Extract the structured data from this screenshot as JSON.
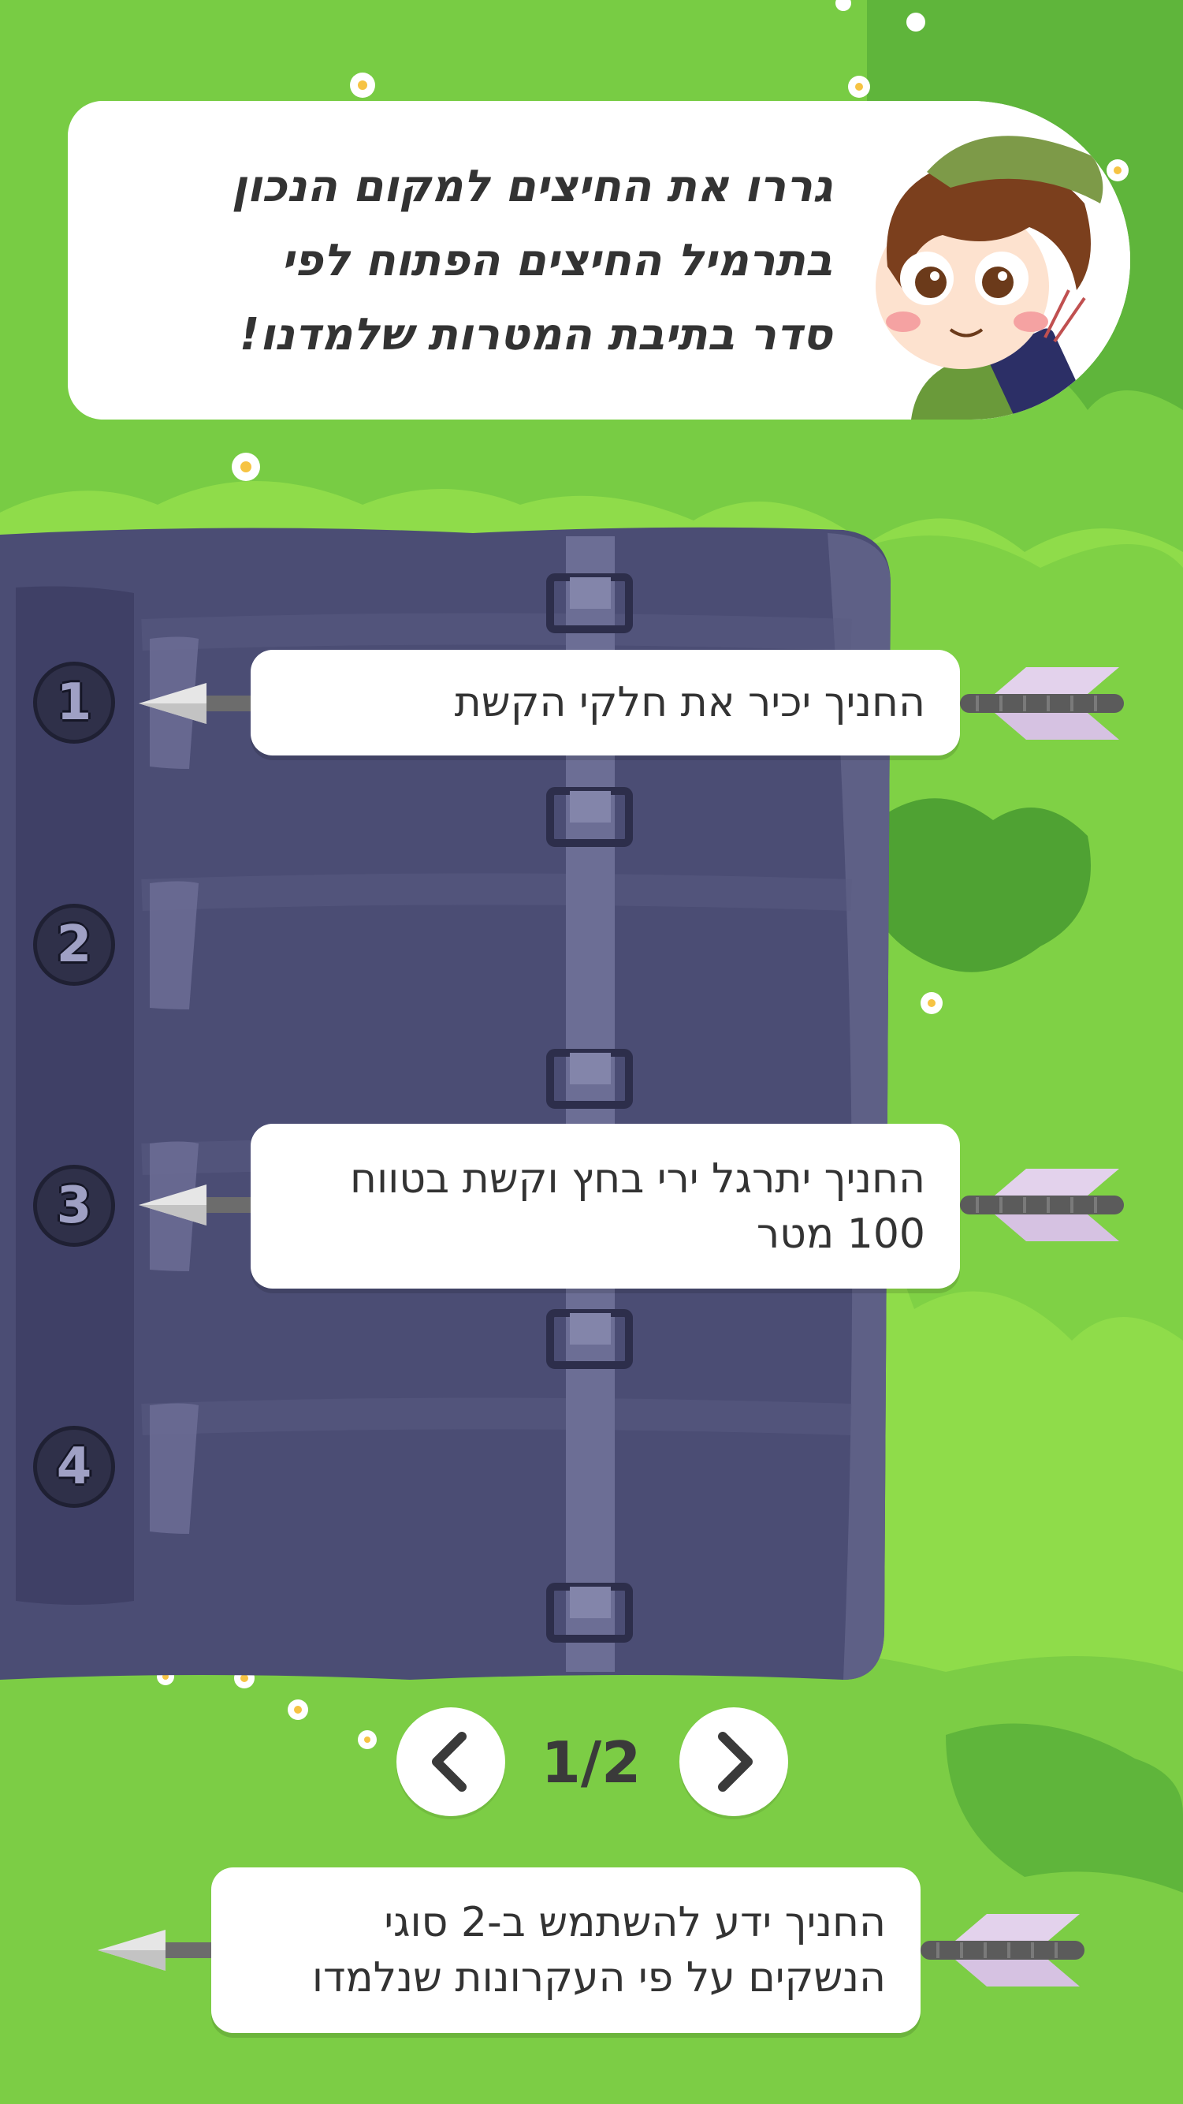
{
  "instructions": {
    "text": "גררו את החיצים למקום הנכון בתרמיל החיצים הפתוח לפי סדר בתיבת המטרות שלמדנו!",
    "line1": "גררו את החיצים למקום הנכון",
    "line2": "בתרמיל החיצים הפתוח לפי",
    "line3": "סדר בתיבת המטרות שלמדנו!"
  },
  "slots": [
    {
      "number": "1",
      "filled": true,
      "card_text": "החניך יכיר את חלקי הקשת"
    },
    {
      "number": "2",
      "filled": false,
      "card_text": ""
    },
    {
      "number": "3",
      "filled": true,
      "card_text": "החניך יתרגל ירי בחץ וקשת בטווח 100 מטר"
    },
    {
      "number": "4",
      "filled": false,
      "card_text": ""
    }
  ],
  "pager": {
    "label": "1/2",
    "prev_icon": "chevron-left-icon",
    "next_icon": "chevron-right-icon"
  },
  "draggable_arrow": {
    "text": "החניך ידע להשתמש ב-2 סוגי הנשקים על פי העקרונות שנלמדו"
  },
  "colors": {
    "grass": "#8fdc4a",
    "quiver": "#4b4d74",
    "quiver_dark": "#3a3b5c",
    "arrow_fletch": "#e3d2ec"
  }
}
